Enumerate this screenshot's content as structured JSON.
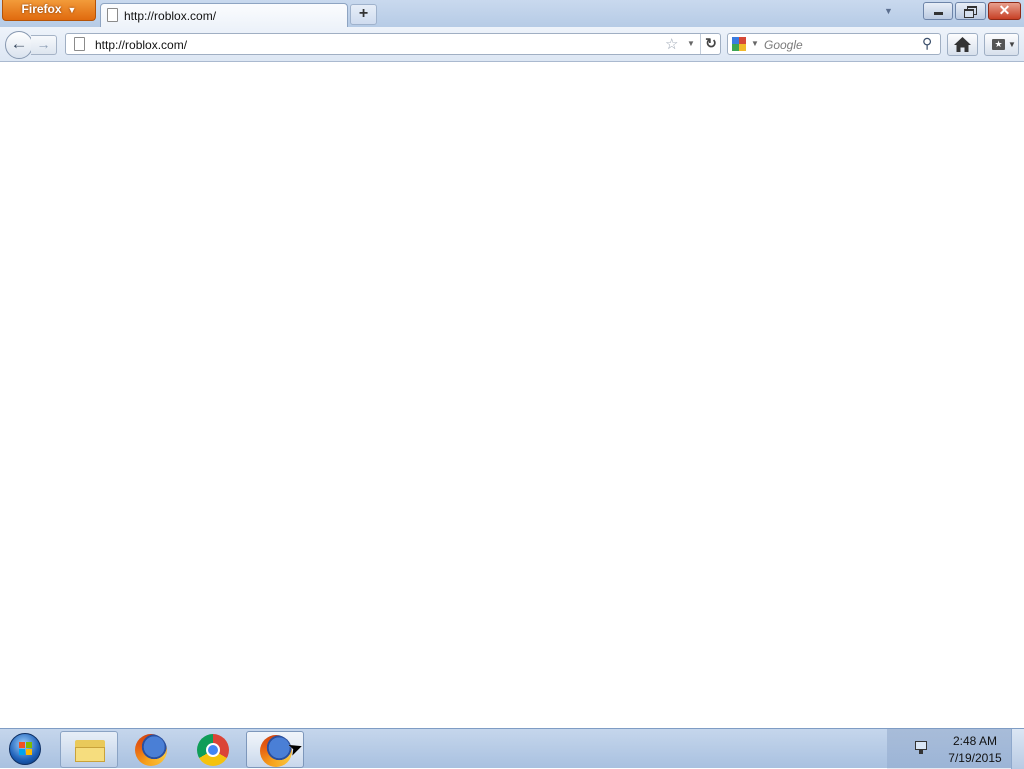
{
  "browser": {
    "menu_button_label": "Firefox",
    "tab": {
      "title": "http://roblox.com/"
    },
    "new_tab_label": "+",
    "url": "http://roblox.com/",
    "search": {
      "placeholder": "Google",
      "engine": "google-icon"
    },
    "icons": {
      "back": "back-arrow-icon",
      "forward": "forward-arrow-icon",
      "bookmark_star": "star-icon",
      "reload": "reload-icon",
      "home": "home-icon",
      "bookmarks": "bookmarks-icon"
    }
  },
  "taskbar": {
    "pinned": [
      {
        "name": "Windows Explorer",
        "icon": "folder-icon"
      },
      {
        "name": "Firefox",
        "icon": "firefox-icon"
      },
      {
        "name": "Google Chrome",
        "icon": "chrome-icon"
      },
      {
        "name": "Firefox (active)",
        "icon": "firefox-icon"
      }
    ],
    "clock": {
      "time": "2:48 AM",
      "date": "7/19/2015"
    }
  },
  "colors": {
    "firefox_button": "#e06a0e",
    "titlebar": "#c9d9ee",
    "taskbar": "#a9c1e0",
    "close_button": "#c74025"
  }
}
